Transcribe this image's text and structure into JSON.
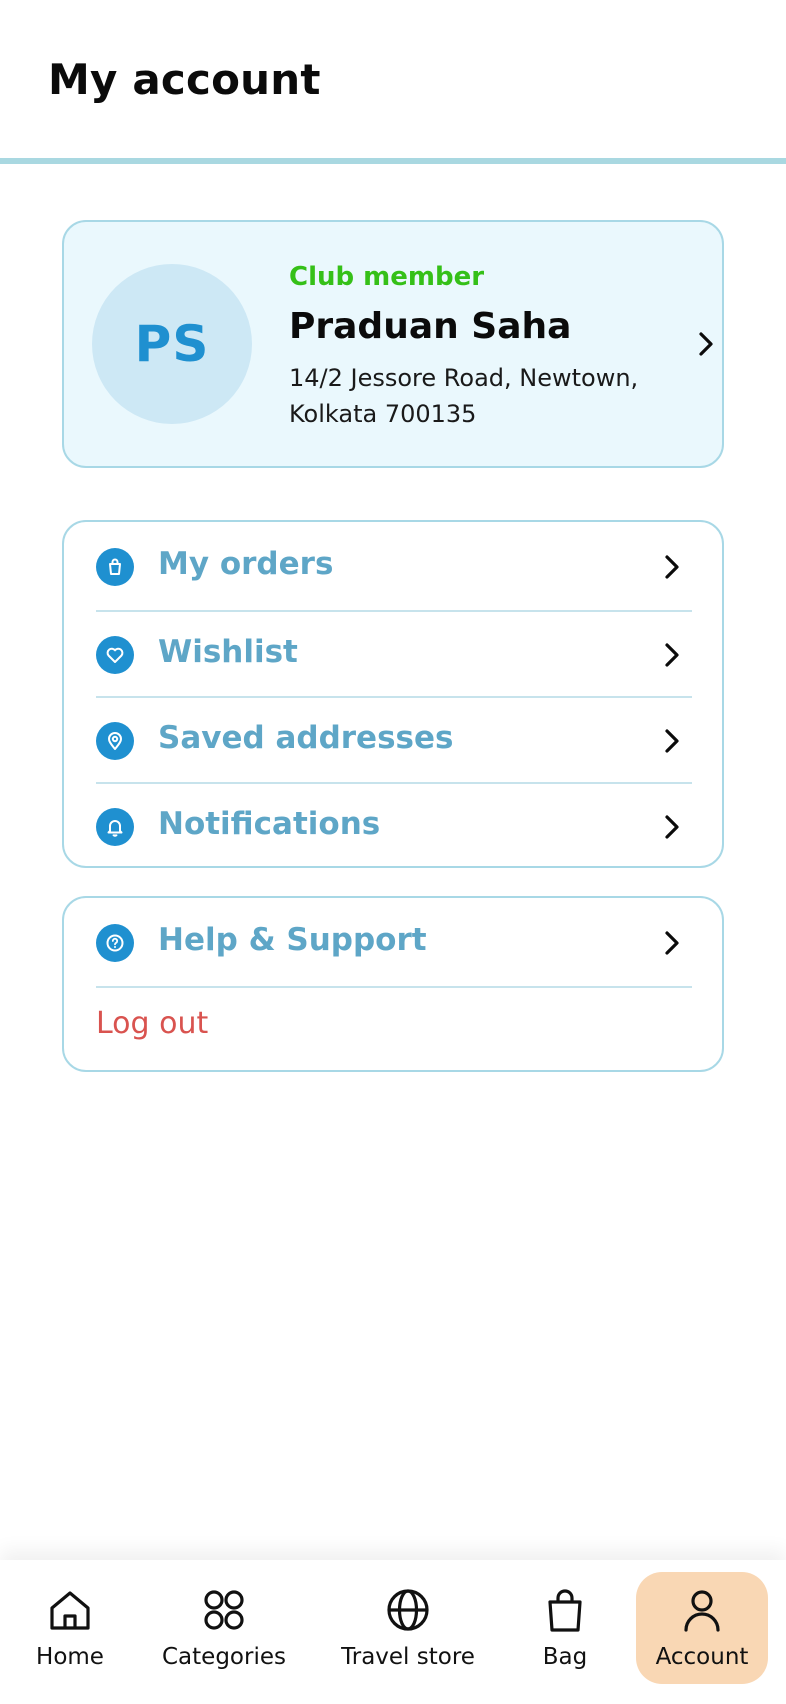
{
  "header": {
    "title": "My account"
  },
  "profile": {
    "initials": "PS",
    "member_label": "Club member",
    "name": "Praduan Saha",
    "address": "14/2 Jessore Road, Newtown, Kolkata 700135"
  },
  "menu": {
    "items": [
      {
        "label": "My orders",
        "icon": "shopping-bag-icon"
      },
      {
        "label": "Wishlist",
        "icon": "heart-icon"
      },
      {
        "label": "Saved addresses",
        "icon": "location-pin-icon"
      },
      {
        "label": "Notifications",
        "icon": "bell-icon"
      }
    ]
  },
  "support": {
    "help_label": "Help & Support",
    "help_icon": "question-circle-icon",
    "logout_label": "Log out"
  },
  "bottom_nav": {
    "items": [
      {
        "label": "Home",
        "icon": "home-icon"
      },
      {
        "label": "Categories",
        "icon": "grid-icon"
      },
      {
        "label": "Travel store",
        "icon": "globe-icon"
      },
      {
        "label": "Bag",
        "icon": "shopping-bag-icon"
      },
      {
        "label": "Account",
        "icon": "user-icon",
        "active": true
      }
    ]
  },
  "colors": {
    "accent": "#1f90d0",
    "member_green": "#35c018",
    "menu_text": "#5ea6c7",
    "logout_red": "#d9534f",
    "active_nav_bg": "#f9d7b4",
    "card_bg": "#eaf8fd",
    "border": "#a8d8e6"
  }
}
